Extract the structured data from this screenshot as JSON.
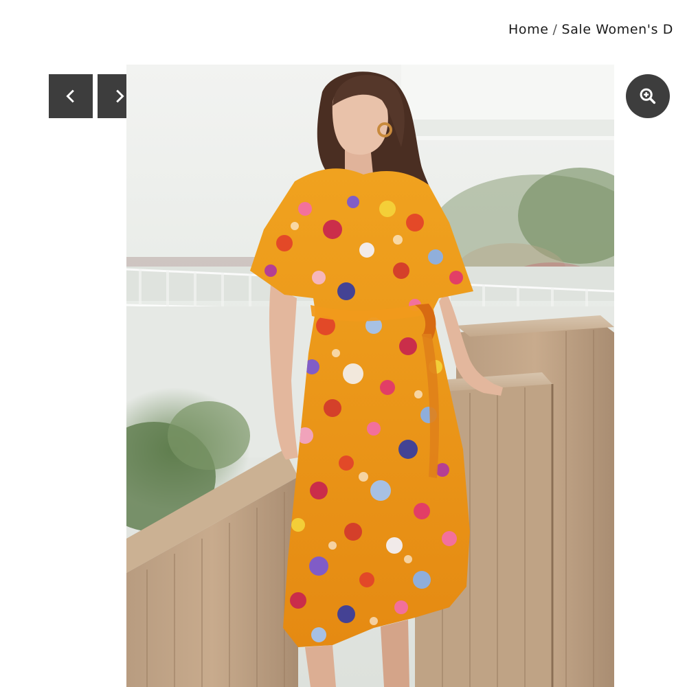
{
  "breadcrumb": {
    "home_label": "Home",
    "separator": "/",
    "current_label": "Sale Women's D"
  },
  "gallery": {
    "prev_icon": "chevron-left-icon",
    "next_icon": "chevron-right-icon",
    "zoom_icon": "zoom-in-icon",
    "button_color": "#3d3d3d"
  },
  "product_image": {
    "subject": "model wearing orange floral wrap midi dress",
    "alt": "Orange floral print wrap dress with flutter sleeves"
  }
}
